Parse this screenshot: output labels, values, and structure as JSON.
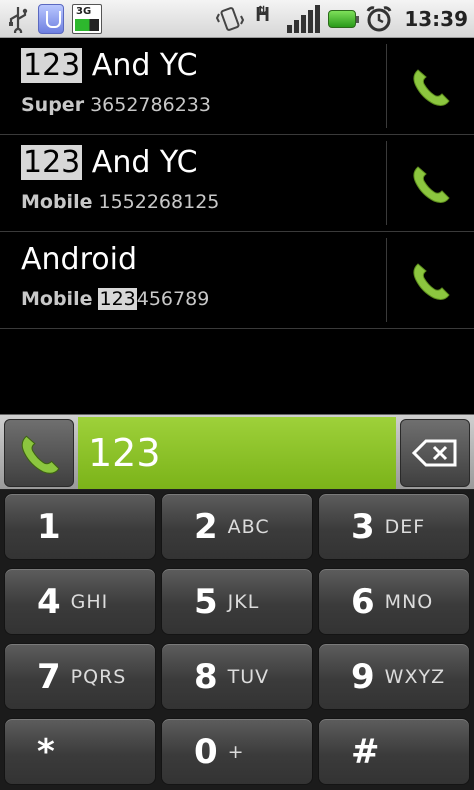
{
  "status_bar": {
    "network_label": "3G",
    "clock": "13:39",
    "icons": [
      "usb-icon",
      "uploader-icon",
      "3g-signal-icon",
      "vibrate-icon",
      "hsdpa-icon",
      "signal-strength-icon",
      "battery-icon",
      "alarm-icon"
    ]
  },
  "contacts": [
    {
      "name_highlight": "123",
      "name_rest": " And YC",
      "type": "Super",
      "number_highlight": "",
      "number_rest": "3652786233"
    },
    {
      "name_highlight": "123",
      "name_rest": " And YC",
      "type": "Mobile",
      "number_highlight": "",
      "number_rest": "1552268125"
    },
    {
      "name_highlight": "",
      "name_rest": "Android",
      "type": "Mobile",
      "number_highlight": "123",
      "number_rest": "456789"
    }
  ],
  "dial_field": {
    "value": "123"
  },
  "keypad": {
    "rows": [
      [
        {
          "digit": "1",
          "letters": ""
        },
        {
          "digit": "2",
          "letters": "ABC"
        },
        {
          "digit": "3",
          "letters": "DEF"
        }
      ],
      [
        {
          "digit": "4",
          "letters": "GHI"
        },
        {
          "digit": "5",
          "letters": "JKL"
        },
        {
          "digit": "6",
          "letters": "MNO"
        }
      ],
      [
        {
          "digit": "7",
          "letters": "PQRS"
        },
        {
          "digit": "8",
          "letters": "TUV"
        },
        {
          "digit": "9",
          "letters": "WXYZ"
        }
      ],
      [
        {
          "digit": "*",
          "letters": ""
        },
        {
          "digit": "0",
          "letters": "+"
        },
        {
          "digit": "#",
          "letters": ""
        }
      ]
    ]
  },
  "colors": {
    "accent_green": "#8cc63f",
    "highlight": "#d7d7d7"
  }
}
